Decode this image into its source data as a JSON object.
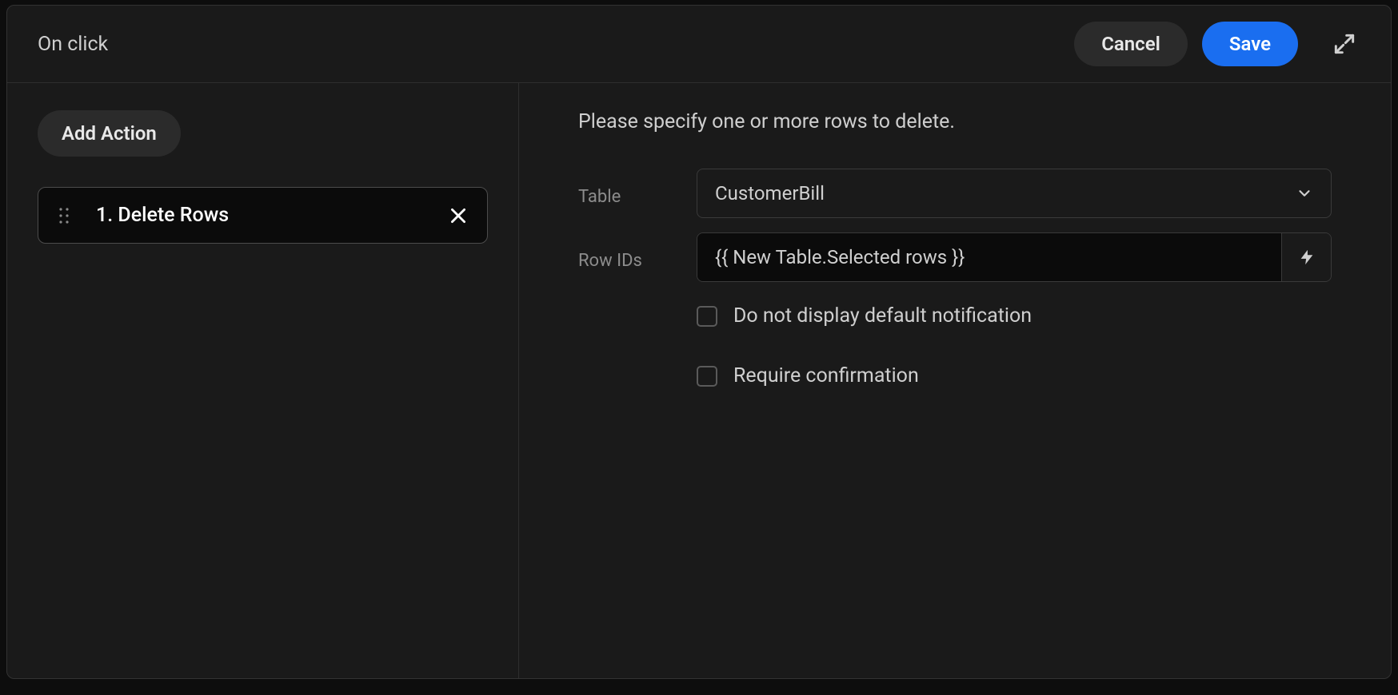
{
  "header": {
    "title": "On click",
    "cancel_label": "Cancel",
    "save_label": "Save"
  },
  "left": {
    "add_action_label": "Add Action",
    "actions": [
      {
        "label": "1. Delete Rows"
      }
    ]
  },
  "right": {
    "instruction": "Please specify one or more rows to delete.",
    "table_label": "Table",
    "table_value": "CustomerBill",
    "row_ids_label": "Row IDs",
    "row_ids_value": "{{ New Table.Selected rows }}",
    "checkbox_no_notification_label": "Do not display default notification",
    "checkbox_require_confirmation_label": "Require confirmation"
  }
}
